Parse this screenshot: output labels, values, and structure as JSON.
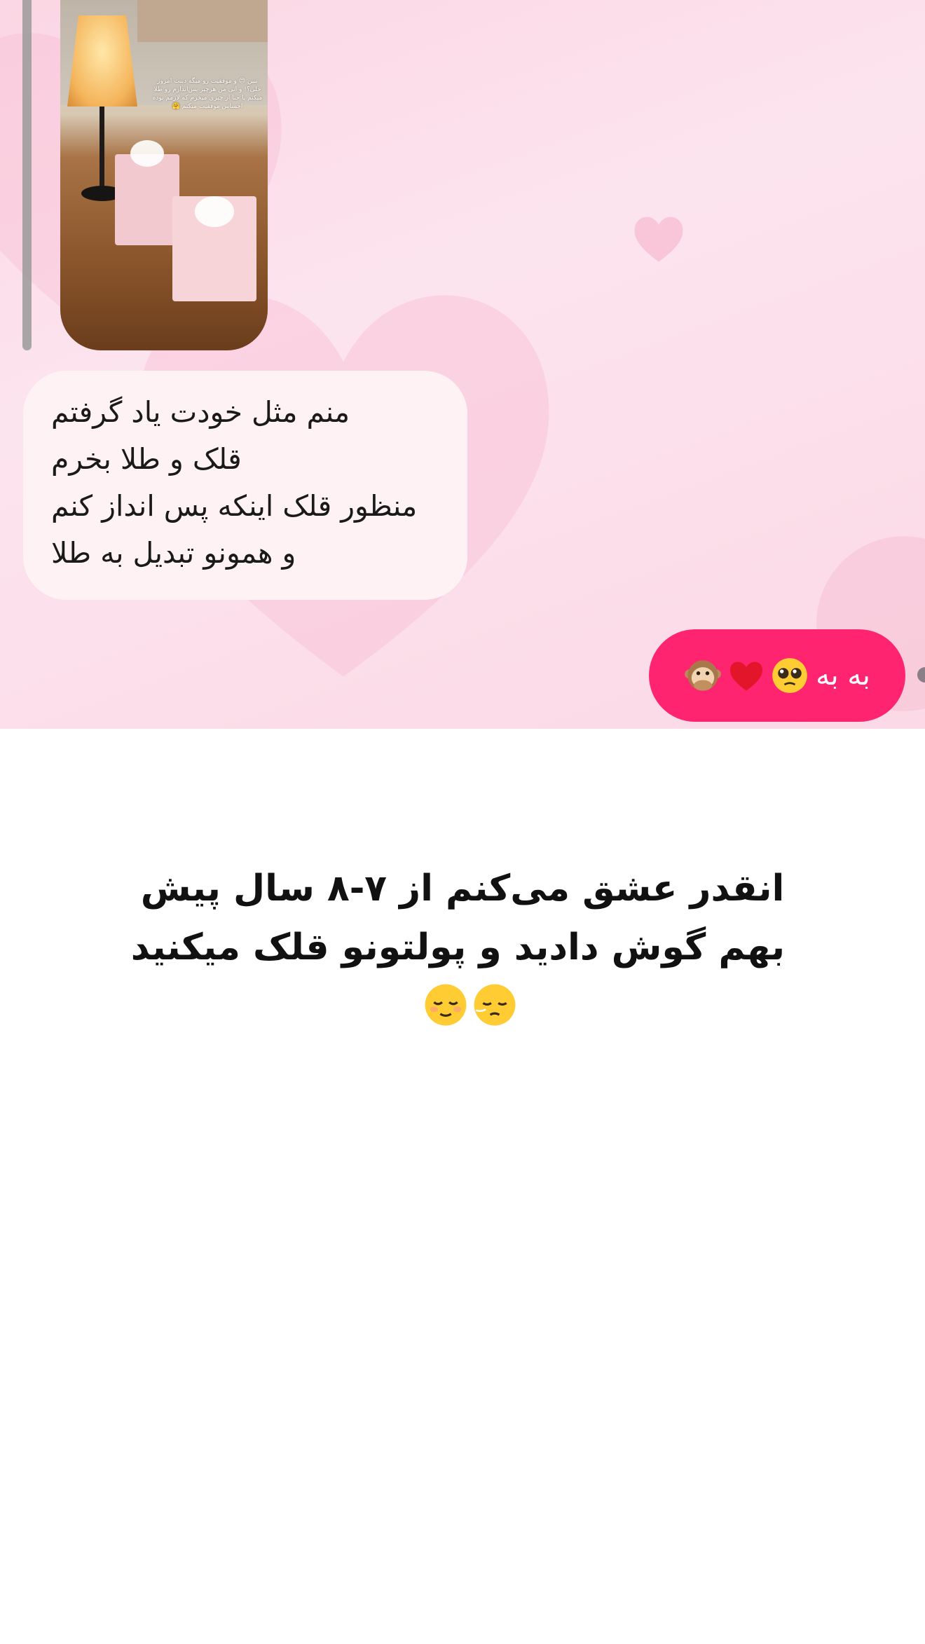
{
  "colors": {
    "chat_background": "#fce4ee",
    "received_bubble": "#fff2f4",
    "sent_bubble": "#ff2470",
    "caption_text": "#111111"
  },
  "story_reply": {
    "overlay_text": "ببین 😍 و موفقیت رو میگه دیبت امروز خلی؟! و اتی من هرچیز پس‌اندازم رو طلا میکنم یا حتا از چیزی میخرم که لازمم بوده احساس موفقیت میکنم 🤗"
  },
  "messages": {
    "received": {
      "lines": [
        "منم مثل خودت یاد گرفتم",
        "قلک و طلا بخرم",
        "منظور قلک اینکه پس انداز کنم",
        "و همونو تبدیل به طلا"
      ]
    },
    "sent": {
      "text": "به به",
      "emojis": [
        "pleading-face-emoji",
        "red-heart-emoji",
        "speak-no-evil-monkey-emoji"
      ]
    }
  },
  "caption": {
    "line1": "انقدر عشق می‌کنم از ۷-۸ سال پیش",
    "line2": "بهم گوش دادید و پولتونو قلک میکنید",
    "emojis": [
      "relieved-face-emoji",
      "sleepy-face-emoji"
    ]
  }
}
